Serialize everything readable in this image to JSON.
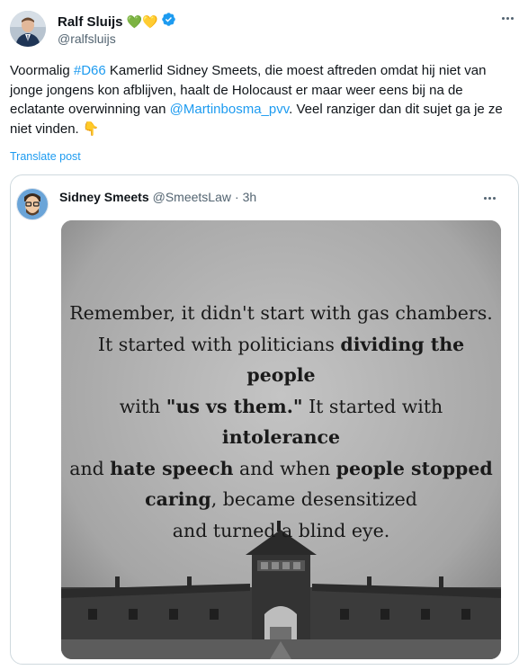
{
  "author": {
    "name": "Ralf Sluijs",
    "emoji": "💚💛",
    "handle": "@ralfsluijs"
  },
  "post": {
    "seg1": "Voormalig ",
    "hashtag": "#D66",
    "seg2": " Kamerlid Sidney Smeets, die moest aftreden omdat hij niet van jonge jongens kon afblijven, haalt de Holocaust er maar weer eens bij na de eclatante overwinning van ",
    "mention": "@Martinbosma_pvv",
    "seg3": ". Veel ranziger dan dit sujet ga je ze niet vinden. ",
    "emoji_end": "👇"
  },
  "translate_label": "Translate post",
  "quote": {
    "name": "Sidney Smeets",
    "handle": "@SmeetsLaw",
    "dot": "·",
    "time": "3h",
    "image_text": {
      "l1": "Remember, it didn't start with gas chambers.",
      "l2a": "It started with politicians ",
      "l2b": "dividing the people",
      "l3a": "with ",
      "l3b": "\"us vs them.\"",
      "l3c": " It started with ",
      "l3d": "intolerance",
      "l4a": "and ",
      "l4b": "hate speech",
      "l4c": " and when ",
      "l4d": "people stopped",
      "l5a": "caring",
      "l5b": ", became desensitized",
      "l6": "and turned a blind eye."
    }
  },
  "colors": {
    "link": "#1d9bf0",
    "verified": "#1d9bf0",
    "muted": "#536471"
  }
}
